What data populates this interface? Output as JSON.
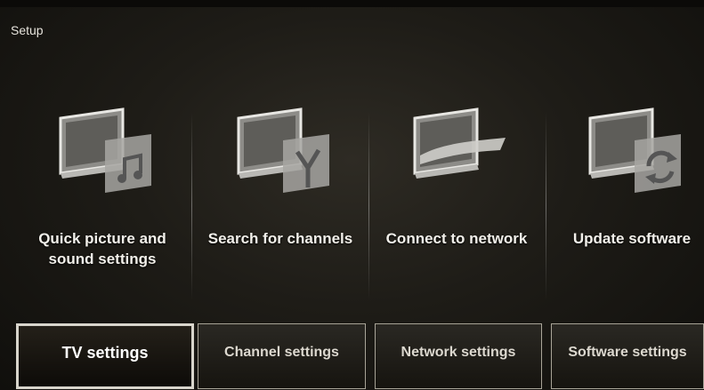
{
  "page": {
    "title": "Setup"
  },
  "tiles": [
    {
      "label_line1": "Quick picture and",
      "label_line2": "sound settings",
      "icon": "music-note-icon"
    },
    {
      "label_line1": "Search for channels",
      "label_line2": "",
      "icon": "antenna-icon"
    },
    {
      "label_line1": "Connect to network",
      "label_line2": "",
      "icon": "network-wave-icon"
    },
    {
      "label_line1": "Update software",
      "label_line2": "",
      "icon": "refresh-icon"
    }
  ],
  "tabs": [
    {
      "label": "TV settings",
      "active": true
    },
    {
      "label": "Channel settings",
      "active": false
    },
    {
      "label": "Network settings",
      "active": false
    },
    {
      "label": "Software settings",
      "active": false
    }
  ],
  "colors": {
    "background": "#1e1c17",
    "text": "#f2f0ea",
    "border": "#d8d5cc"
  }
}
